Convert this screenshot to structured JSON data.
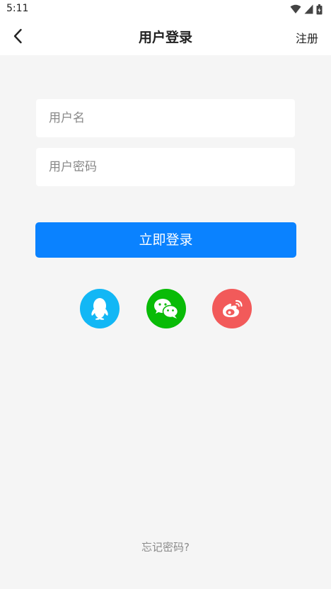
{
  "status_bar": {
    "time": "5:11",
    "icons": [
      "wifi-icon",
      "signal-icon",
      "battery-icon"
    ]
  },
  "navbar": {
    "back_icon": "chevron-left-icon",
    "title": "用户登录",
    "register_label": "注册"
  },
  "form": {
    "username_placeholder": "用户名",
    "username_value": "",
    "password_placeholder": "用户密码",
    "password_value": "",
    "login_label": "立即登录"
  },
  "social_login": [
    {
      "name": "qq",
      "icon": "qq-icon",
      "color": "#12b7f5"
    },
    {
      "name": "wechat",
      "icon": "wechat-icon",
      "color": "#09bb07"
    },
    {
      "name": "weibo",
      "icon": "weibo-icon",
      "color": "#f25a5a"
    }
  ],
  "footer": {
    "forgot_label": "忘记密码?"
  },
  "colors": {
    "background": "#f5f5f5",
    "primary": "#0a82ff",
    "surface": "#ffffff"
  }
}
